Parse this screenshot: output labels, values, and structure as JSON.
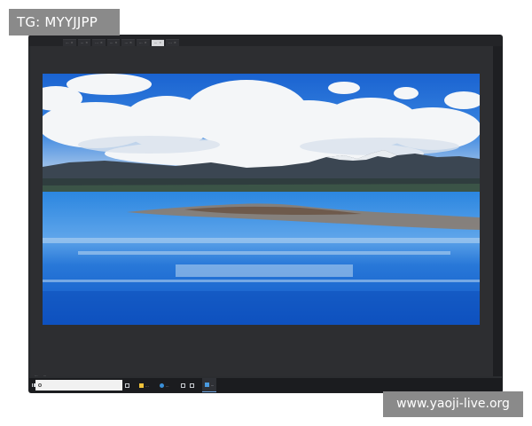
{
  "overlay": {
    "top_left_tag": "TG: MYYJJPP",
    "bottom_right_tag": "www.yaoji-live.org"
  },
  "viewer": {
    "tabs": [
      {
        "label": "…",
        "active": false
      },
      {
        "label": "…",
        "active": false
      },
      {
        "label": "…",
        "active": false
      },
      {
        "label": "…",
        "active": false
      },
      {
        "label": "…",
        "active": false
      },
      {
        "label": "…",
        "active": false
      },
      {
        "label": "…",
        "active": true
      },
      {
        "label": "…",
        "active": false
      }
    ],
    "status_left": "…",
    "status_right": "…"
  },
  "photo": {
    "subject": "mountain-lake-landscape",
    "sky_color": "#1f6fd6",
    "lake_color": "#1e6fd0",
    "mountain_color": "#3b4652"
  },
  "taskbar": {
    "icons": [
      "windows-start-icon",
      "search-icon",
      "task-view-icon",
      "folder-icon",
      "edge-icon",
      "camera-icon",
      "mail-icon"
    ],
    "apps": [
      {
        "label": "…",
        "active": false,
        "color": "#f0c23a"
      },
      {
        "label": "…",
        "active": false,
        "color": "#3a8fd8"
      },
      {
        "label": "…",
        "active": true,
        "color": "#4a9be0"
      }
    ]
  }
}
